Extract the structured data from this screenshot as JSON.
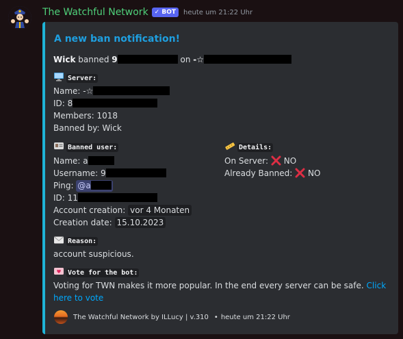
{
  "message": {
    "username": "The Watchful Network",
    "bot_tag": "✓ BOT",
    "timestamp": "heute um 21:22 Uhr"
  },
  "embed": {
    "accent_color": "#1fb3d6",
    "title": "A new ban notification!",
    "intro": {
      "actor": "Wick",
      "verb": "banned",
      "target_prefix": "9",
      "on_word": "on",
      "server_prefix": "-☆"
    },
    "server": {
      "field": "Server:",
      "name_label": "Name:",
      "name_prefix": "-☆",
      "id_label": "ID:",
      "id_prefix": "8",
      "members_label": "Members:",
      "members_value": "1018",
      "banned_by_label": "Banned by:",
      "banned_by_value": "Wick"
    },
    "banned_user": {
      "field": "Banned user:",
      "name_label": "Name:",
      "name_prefix": "a",
      "username_label": "Username:",
      "username_prefix": "9",
      "ping_label": "Ping:",
      "ping_prefix": "@a",
      "id_label": "ID:",
      "id_prefix": "11",
      "account_creation_label": "Account creation:",
      "account_creation_value": "vor 4 Monaten",
      "creation_date_label": "Creation date:",
      "creation_date_value": "15.10.2023"
    },
    "details": {
      "field": "Details:",
      "on_server_label": "On Server:",
      "on_server_value": "NO",
      "already_banned_label": "Already Banned:",
      "already_banned_value": "NO"
    },
    "reason": {
      "field": "Reason:",
      "text": "account suspicious."
    },
    "vote": {
      "field": "Vote for the bot:",
      "text": "Voting for TWN makes it more popular. In the end every server can be safe.",
      "link_part1": "Click",
      "link_part2": "here to vote"
    },
    "footer": {
      "text": "The Watchful Network by ILLucy | v.310",
      "separator": "•",
      "time": "heute um 21:22 Uhr"
    }
  }
}
